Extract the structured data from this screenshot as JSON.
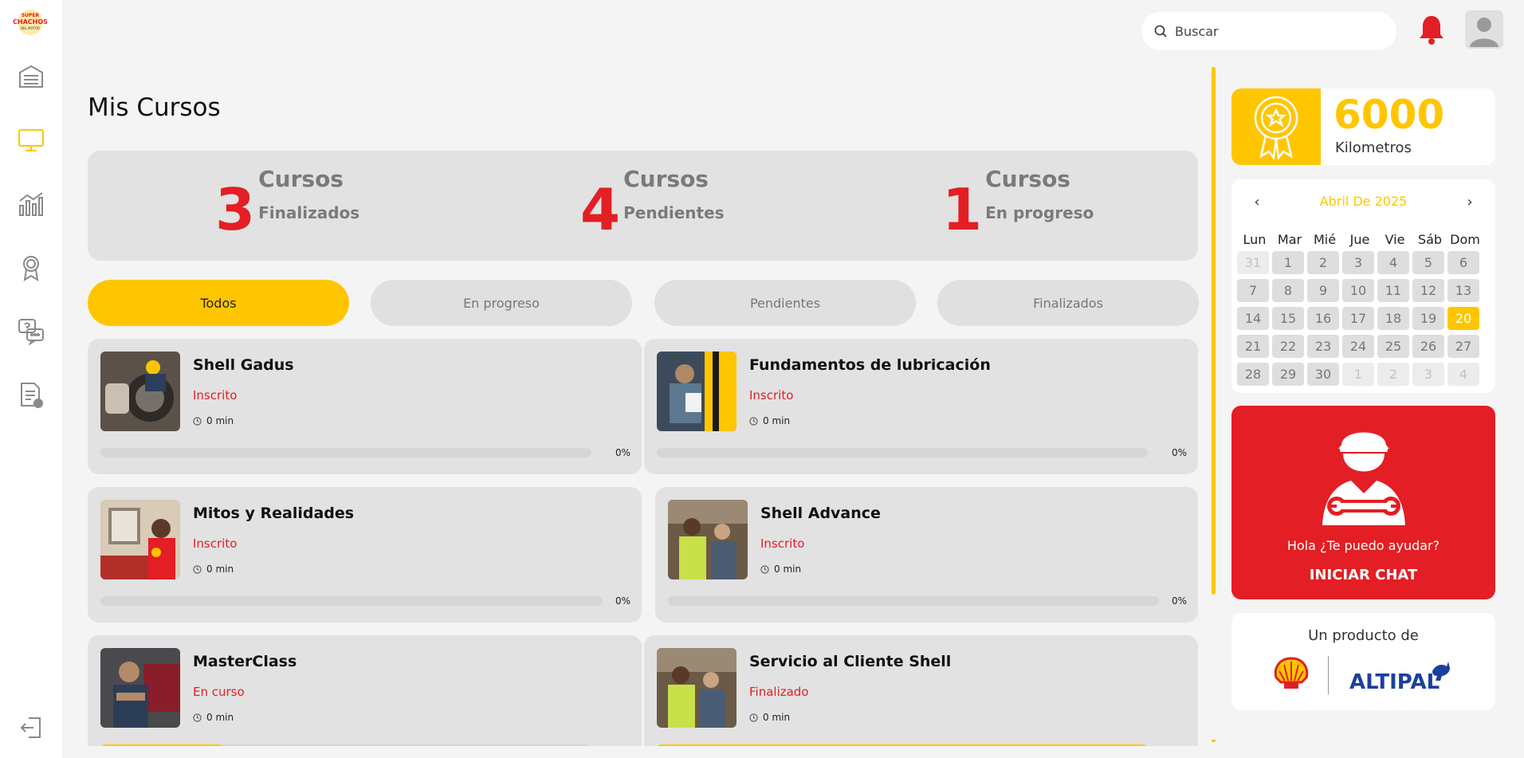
{
  "brand": {
    "logo_text_top": "SUPER",
    "logo_text_main": "CHACHOS",
    "logo_text_bottom": "DEL MOTOR"
  },
  "sidebar": {
    "items": [
      {
        "icon": "garage-icon"
      },
      {
        "icon": "monitor-icon",
        "active": true
      },
      {
        "icon": "chart-icon"
      },
      {
        "icon": "award-icon"
      },
      {
        "icon": "chat-help-icon"
      },
      {
        "icon": "document-icon"
      }
    ],
    "logout_icon": "logout-icon"
  },
  "header": {
    "search_placeholder": "Buscar"
  },
  "page": {
    "title": "Mis Cursos"
  },
  "stats": [
    {
      "value": "3",
      "label": "Cursos",
      "sub": "Finalizados"
    },
    {
      "value": "4",
      "label": "Cursos",
      "sub": "Pendientes"
    },
    {
      "value": "1",
      "label": "Cursos",
      "sub": "En progreso"
    }
  ],
  "tabs": [
    {
      "label": "Todos",
      "active": true
    },
    {
      "label": "En progreso"
    },
    {
      "label": "Pendientes"
    },
    {
      "label": "Finalizados"
    }
  ],
  "courses": [
    {
      "title": "Shell Gadus",
      "status": "Inscrito",
      "time": "0 min",
      "progress": 0,
      "progress_label": "0%"
    },
    {
      "title": "Fundamentos de lubricación",
      "status": "Inscrito",
      "time": "0 min",
      "progress": 0,
      "progress_label": "0%"
    },
    {
      "title": "Mitos y Realidades",
      "status": "Inscrito",
      "time": "0 min",
      "progress": 0,
      "progress_label": "0%"
    },
    {
      "title": "Shell Advance",
      "status": "Inscrito",
      "time": "0 min",
      "progress": 0,
      "progress_label": "0%"
    },
    {
      "title": "MasterClass",
      "status": "En curso",
      "time": "0 min",
      "progress": 0.25,
      "progress_label": ""
    },
    {
      "title": "Servicio al Cliente Shell",
      "status": "Finalizado",
      "time": "0 min",
      "progress": 1,
      "progress_label": ""
    }
  ],
  "kilometers": {
    "value": "6000",
    "label": "Kilometros"
  },
  "calendar": {
    "month_label": "Abril De 2025",
    "weekdays": [
      "Lun",
      "Mar",
      "Mié",
      "Jue",
      "Vie",
      "Sáb",
      "Dom"
    ],
    "days": [
      {
        "d": "31",
        "out": true
      },
      {
        "d": "1"
      },
      {
        "d": "2"
      },
      {
        "d": "3"
      },
      {
        "d": "4"
      },
      {
        "d": "5"
      },
      {
        "d": "6"
      },
      {
        "d": "7"
      },
      {
        "d": "8"
      },
      {
        "d": "9"
      },
      {
        "d": "10"
      },
      {
        "d": "11"
      },
      {
        "d": "12"
      },
      {
        "d": "13"
      },
      {
        "d": "14"
      },
      {
        "d": "15"
      },
      {
        "d": "16"
      },
      {
        "d": "17"
      },
      {
        "d": "18"
      },
      {
        "d": "19"
      },
      {
        "d": "20",
        "today": true
      },
      {
        "d": "21"
      },
      {
        "d": "22"
      },
      {
        "d": "23"
      },
      {
        "d": "24"
      },
      {
        "d": "25"
      },
      {
        "d": "26"
      },
      {
        "d": "27"
      },
      {
        "d": "28"
      },
      {
        "d": "29"
      },
      {
        "d": "30"
      },
      {
        "d": "1",
        "out": true
      },
      {
        "d": "2",
        "out": true
      },
      {
        "d": "3",
        "out": true
      },
      {
        "d": "4",
        "out": true
      }
    ]
  },
  "help": {
    "greeting": "Hola ¿Te puedo ayudar?",
    "cta": "INICIAR CHAT"
  },
  "partners": {
    "title": "Un producto de",
    "logo_1": "Shell",
    "logo_2": "ALTIPAL"
  },
  "colors": {
    "accent": "#ffc600",
    "red": "#e31e24",
    "card": "#e2e2e2",
    "bg": "#f4f4f4"
  }
}
